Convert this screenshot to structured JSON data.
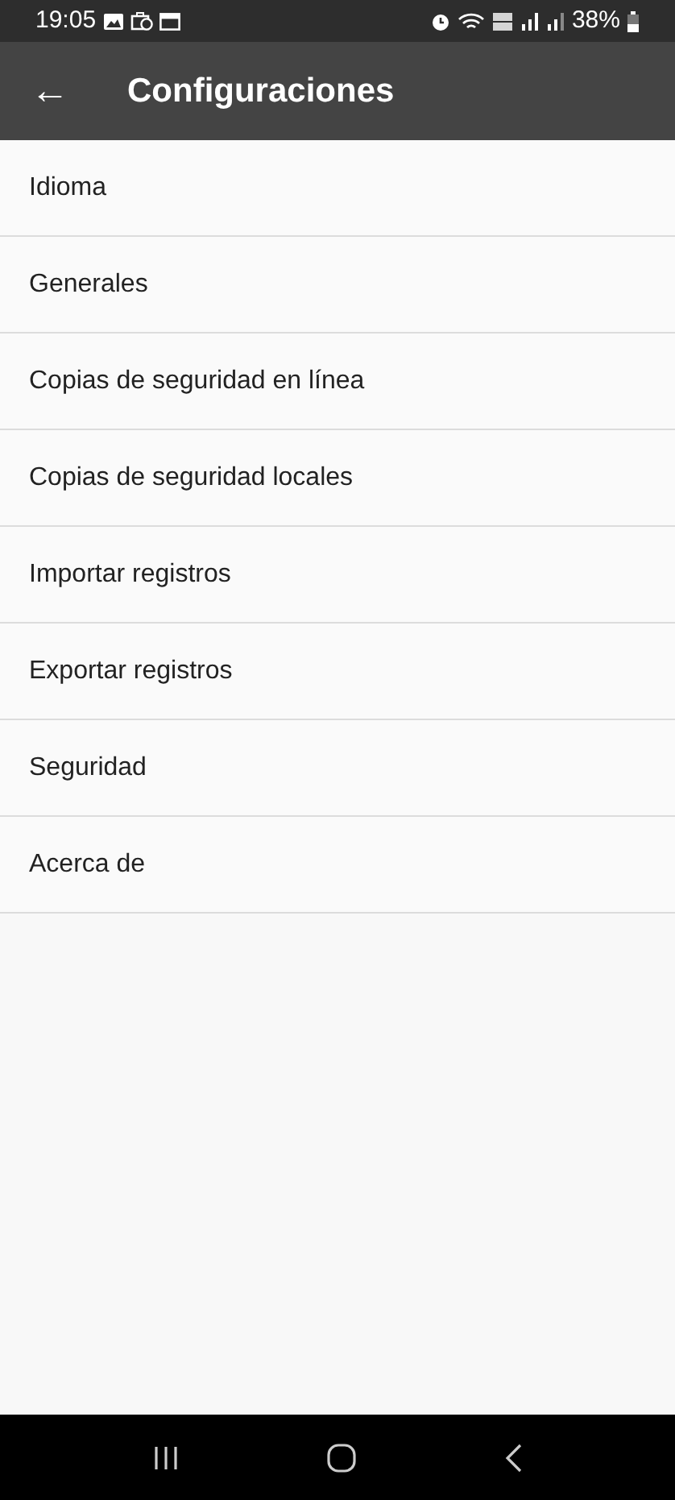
{
  "status_bar": {
    "time": "19:05",
    "battery": "38%"
  },
  "app_bar": {
    "back": "←",
    "title": "Configuraciones"
  },
  "settings": [
    {
      "label": "Idioma"
    },
    {
      "label": "Generales"
    },
    {
      "label": "Copias de seguridad en línea"
    },
    {
      "label": "Copias de seguridad locales"
    },
    {
      "label": "Importar registros"
    },
    {
      "label": "Exportar registros"
    },
    {
      "label": "Seguridad"
    },
    {
      "label": "Acerca de"
    }
  ]
}
